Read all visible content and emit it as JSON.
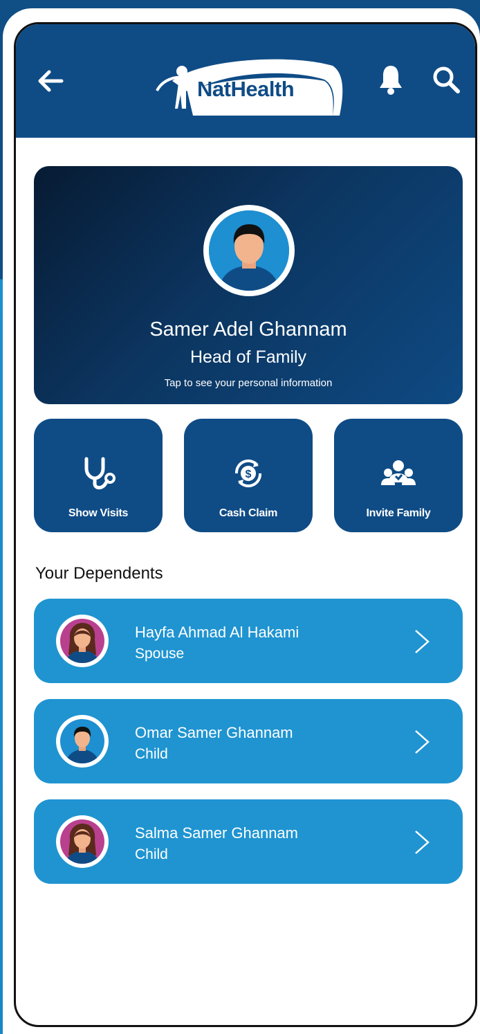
{
  "header": {
    "logo_text": "NatHealth",
    "back_icon": "arrow-left-icon",
    "bell_icon": "bell-icon",
    "search_icon": "search-icon"
  },
  "profile": {
    "name": "Samer Adel Ghannam",
    "role": "Head of Family",
    "hint": "Tap to see your personal information"
  },
  "actions": [
    {
      "label": "Show Visits",
      "icon": "stethoscope-icon"
    },
    {
      "label": "Cash Claim",
      "icon": "cash-claim-icon"
    },
    {
      "label": "Invite Family",
      "icon": "family-icon"
    }
  ],
  "dependents_title": "Your Dependents",
  "dependents": [
    {
      "name": "Hayfa Ahmad Al Hakami",
      "relation": "Spouse",
      "avatar": "female-avatar"
    },
    {
      "name": "Omar Samer Ghannam",
      "relation": "Child",
      "avatar": "male-avatar"
    },
    {
      "name": "Salma Samer Ghannam",
      "relation": "Child",
      "avatar": "female-avatar"
    }
  ],
  "colors": {
    "primary": "#0f4c86",
    "accent": "#1f94d1"
  }
}
